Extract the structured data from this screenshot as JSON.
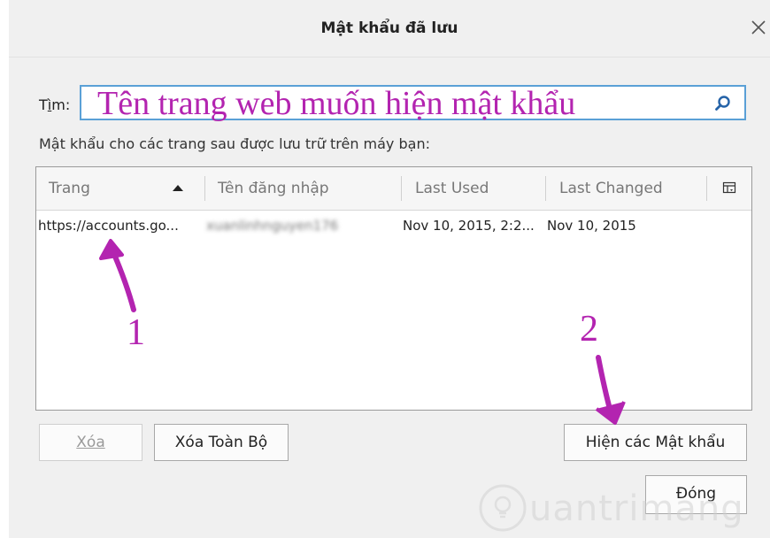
{
  "window": {
    "title": "Mật khẩu đã lưu"
  },
  "search": {
    "label": "Tìm:",
    "value": "Tên trang web muốn hiện mật khẩu"
  },
  "description": "Mật khẩu cho các trang sau được lưu trữ trên máy bạn:",
  "table": {
    "columns": [
      "Trang",
      "Tên đăng nhập",
      "Last Used",
      "Last Changed"
    ],
    "rows": [
      {
        "site": "https://accounts.go...",
        "username": "xuanlinhnguyen176",
        "last_used": "Nov 10, 2015, 2:2...",
        "last_changed": "Nov 10, 2015"
      }
    ]
  },
  "buttons": {
    "remove": "Xóa",
    "remove_all": "Xóa Toàn Bộ",
    "show_passwords": "Hiện các Mật khẩu",
    "close": "Đóng"
  },
  "annotations": {
    "one": "1",
    "two": "2"
  },
  "watermark": "uantrimang",
  "colors": {
    "annotation": "#b324b0",
    "focus_border": "#5aa0d6",
    "dialog_bg": "#f0f0f0"
  }
}
